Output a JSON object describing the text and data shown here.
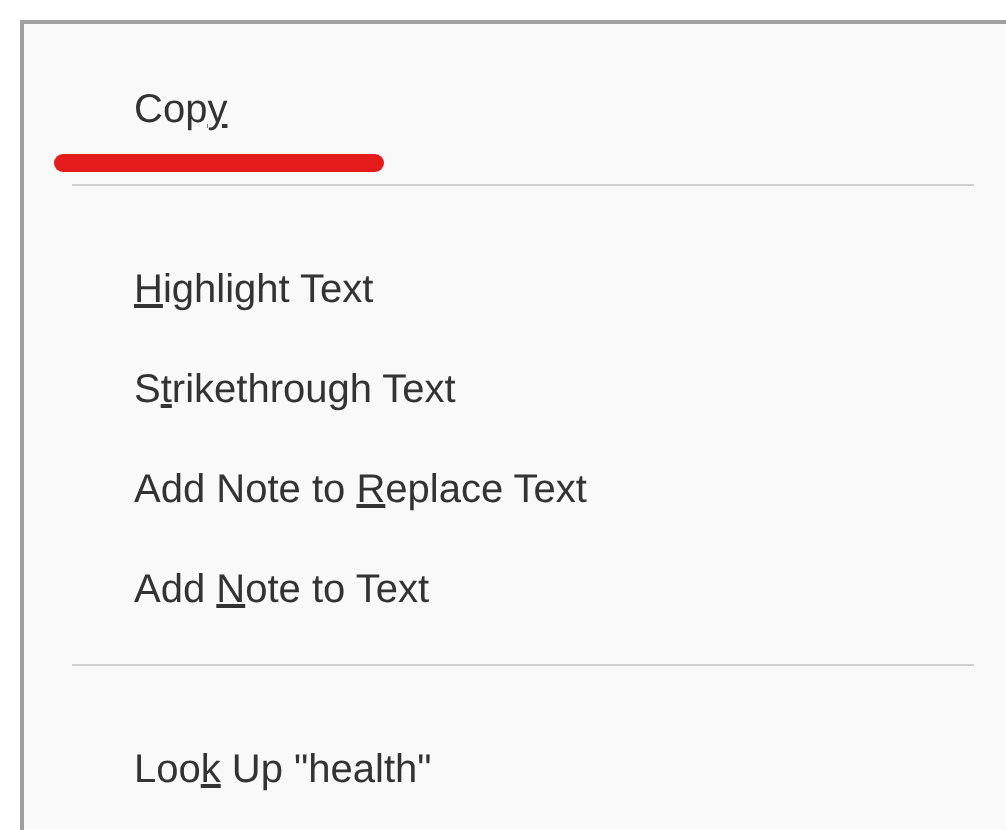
{
  "context_menu": {
    "groups": [
      {
        "items": [
          {
            "before": "Cop",
            "access_key": "y",
            "annotation": {
              "kind": "underline-stroke"
            }
          }
        ]
      },
      {
        "items": [
          {
            "access_key": "H",
            "after": "ighlight Text"
          },
          {
            "before": "S",
            "access_key": "t",
            "after": "rikethrough Text"
          },
          {
            "before": "Add Note to ",
            "access_key": "R",
            "after": "eplace Text"
          },
          {
            "before": "Add ",
            "access_key": "N",
            "after": "ote to Text"
          }
        ]
      },
      {
        "items": [
          {
            "before": "Loo",
            "access_key": "k",
            "after": " Up \"health\""
          }
        ]
      }
    ]
  }
}
